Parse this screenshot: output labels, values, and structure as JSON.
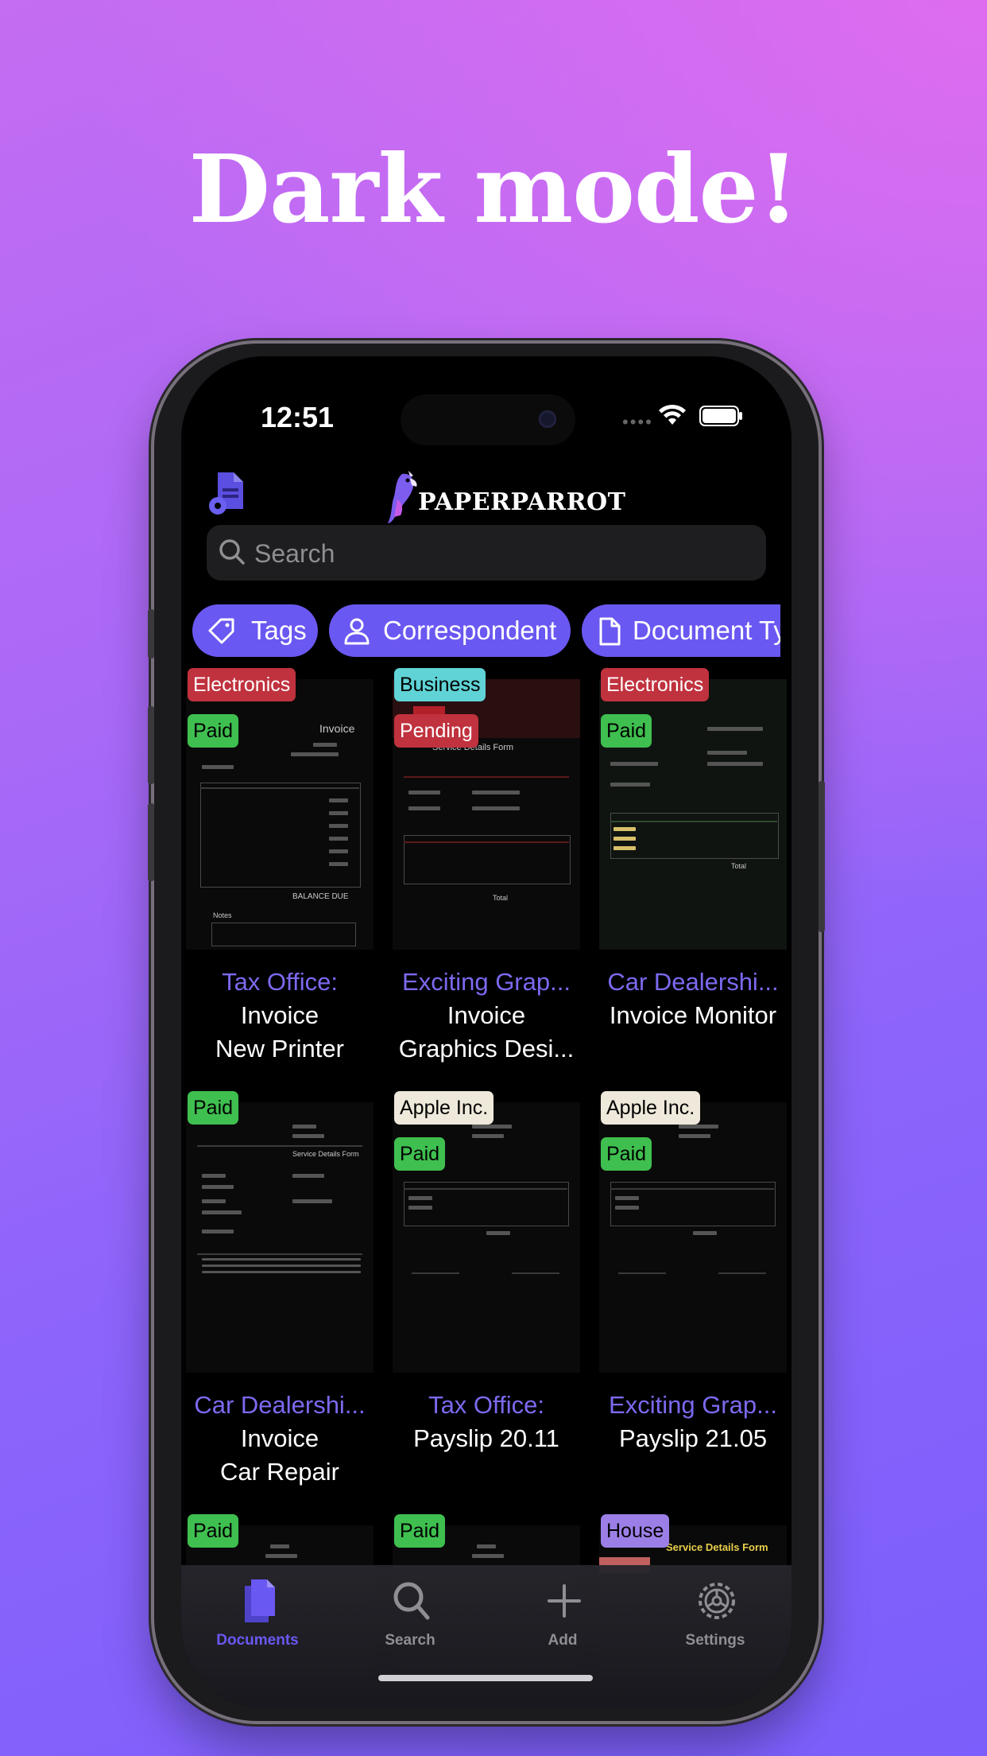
{
  "headline": "Dark mode!",
  "status": {
    "time": "12:51"
  },
  "app": {
    "brand": "PAPERPARROT"
  },
  "search": {
    "placeholder": "Search"
  },
  "filters": [
    {
      "label": "Tags",
      "icon": "tag-icon"
    },
    {
      "label": "Correspondent",
      "icon": "person-icon"
    },
    {
      "label": "Document Ty",
      "icon": "document-icon"
    }
  ],
  "documents": [
    {
      "correspondent": "Tax Office:",
      "title": "Invoice",
      "subtitle": "New Printer",
      "tags": [
        {
          "label": "Electronics",
          "bg": "#c0323e",
          "fg": "#ffffff"
        },
        {
          "label": "Paid",
          "bg": "#3fbf4f",
          "fg": "#000000"
        }
      ]
    },
    {
      "correspondent": "Exciting Grap...",
      "title": "Invoice",
      "subtitle": "Graphics Desi...",
      "tags": [
        {
          "label": "Business",
          "bg": "#5fd3d6",
          "fg": "#000000"
        },
        {
          "label": "Pending",
          "bg": "#c0323e",
          "fg": "#ffffff"
        }
      ]
    },
    {
      "correspondent": "Car Dealershi...",
      "title": "Invoice Monitor",
      "subtitle": "",
      "tags": [
        {
          "label": "Electronics",
          "bg": "#c0323e",
          "fg": "#ffffff"
        },
        {
          "label": "Paid",
          "bg": "#3fbf4f",
          "fg": "#000000"
        }
      ]
    },
    {
      "correspondent": "Car Dealershi...",
      "title": "Invoice",
      "subtitle": "Car Repair",
      "tags": [
        {
          "label": "Paid",
          "bg": "#3fbf4f",
          "fg": "#000000"
        }
      ]
    },
    {
      "correspondent": "Tax Office:",
      "title": "Payslip 20.11",
      "subtitle": "",
      "tags": [
        {
          "label": "Apple Inc.",
          "bg": "#efe9db",
          "fg": "#000000"
        },
        {
          "label": "Paid",
          "bg": "#3fbf4f",
          "fg": "#000000"
        }
      ]
    },
    {
      "correspondent": "Exciting Grap...",
      "title": "Payslip 21.05",
      "subtitle": "",
      "tags": [
        {
          "label": "Apple Inc.",
          "bg": "#efe9db",
          "fg": "#000000"
        },
        {
          "label": "Paid",
          "bg": "#3fbf4f",
          "fg": "#000000"
        }
      ]
    },
    {
      "correspondent": "",
      "title": "",
      "subtitle": "",
      "tags": [
        {
          "label": "Paid",
          "bg": "#3fbf4f",
          "fg": "#000000"
        }
      ]
    },
    {
      "correspondent": "",
      "title": "",
      "subtitle": "",
      "tags": [
        {
          "label": "Paid",
          "bg": "#3fbf4f",
          "fg": "#000000"
        }
      ]
    },
    {
      "correspondent": "",
      "title": "",
      "subtitle": "",
      "tags": [
        {
          "label": "House",
          "bg": "#9b7fe6",
          "fg": "#000000"
        }
      ]
    }
  ],
  "thumb_texts": {
    "invoice": "Invoice",
    "service_form": "Service Details Form",
    "balance_due": "BALANCE DUE",
    "total": "Total",
    "notes": "Notes"
  },
  "tabs": [
    {
      "label": "Documents",
      "icon": "documents-icon",
      "active": true
    },
    {
      "label": "Search",
      "icon": "search-icon",
      "active": false
    },
    {
      "label": "Add",
      "icon": "plus-icon",
      "active": false
    },
    {
      "label": "Settings",
      "icon": "gear-icon",
      "active": false
    }
  ],
  "colors": {
    "accent": "#6a58f2",
    "correspondent": "#7b6af0",
    "background": "#000000"
  }
}
